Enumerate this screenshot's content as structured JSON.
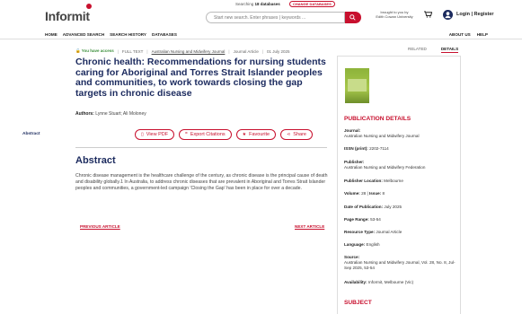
{
  "header": {
    "logo_text": "Informit",
    "searching_prefix": "Searching",
    "db_count": "18 databases",
    "change_db": "CHANGE DATABASES",
    "search_placeholder": "Start new search. Enter phrases | keywords ...",
    "brought_line1": "brought to you by",
    "brought_line2": "Edith Cowan University",
    "login": "Login | Register"
  },
  "nav": {
    "left": [
      "HOME",
      "ADVANCED SEARCH",
      "SEARCH HISTORY",
      "DATABASES"
    ],
    "right": [
      "ABOUT US",
      "HELP"
    ]
  },
  "article": {
    "access": "You have access",
    "type_full": "FULL TEXT",
    "journal_link": "Australian Nursing and Midwifery Journal",
    "item_type": "Journal Article",
    "date": "01 July 2025",
    "title": "Chronic health: Recommendations for nursing students caring for Aboriginal and Torres Strait Islander peoples and communities, to work towards closing the gap targets in chronic disease",
    "authors_label": "Authors:",
    "authors": "Lynne Stuart; Ali Moloney",
    "side_label": "Abstract",
    "actions": {
      "pdf": "View PDF",
      "export": "Export Citations",
      "favourite": "Favourite",
      "share": "Share"
    },
    "abstract_heading": "Abstract",
    "abstract_text": "Chronic disease management is the healthcare challenge of the century, as chronic disease is the principal cause of death and disability globally.1 In Australia, to address chronic diseases that are prevalent in Aboriginal and Torres Strait Islander peoples and communities, a government-led campaign 'Closing the Gap' has been in place for over a decade.",
    "prev": "PREVIOUS ARTICLE",
    "next": "NEXT ARTICLE"
  },
  "panel": {
    "tabs": [
      "RELATED",
      "DETAILS"
    ],
    "active_tab": "DETAILS",
    "heading": "PUBLICATION DETAILS",
    "journal_label": "Journal:",
    "journal_value": "Australian Nursing and Midwifery Journal",
    "issn_label": "ISSN (print):",
    "issn_value": "2202-7114",
    "publisher_label": "Publisher:",
    "publisher_value": "Australian Nursing and Midwifery Federation",
    "location_label": "Publisher Location:",
    "location_value": "Melbourne",
    "volume_label": "Volume:",
    "volume_value": "28",
    "issue_label": "Issue:",
    "issue_value": "8",
    "pubdate_label": "Date of Publication:",
    "pubdate_value": "July 2025",
    "pages_label": "Page Range:",
    "pages_value": "53-54",
    "restype_label": "Resource Type:",
    "restype_value": "Journal Article",
    "lang_label": "Language:",
    "lang_value": "English",
    "source_label": "Source:",
    "source_value": "Australian Nursing and Midwifery Journal, Vol. 28, No. 8, Jul-Sep 2025, 53-54",
    "avail_label": "Availability:",
    "avail_value": "Informit, Melbourne (Vic)",
    "subject_heading": "SUBJECT"
  },
  "colors": {
    "brand_red": "#c8102e",
    "title_navy": "#1b2a5e"
  }
}
